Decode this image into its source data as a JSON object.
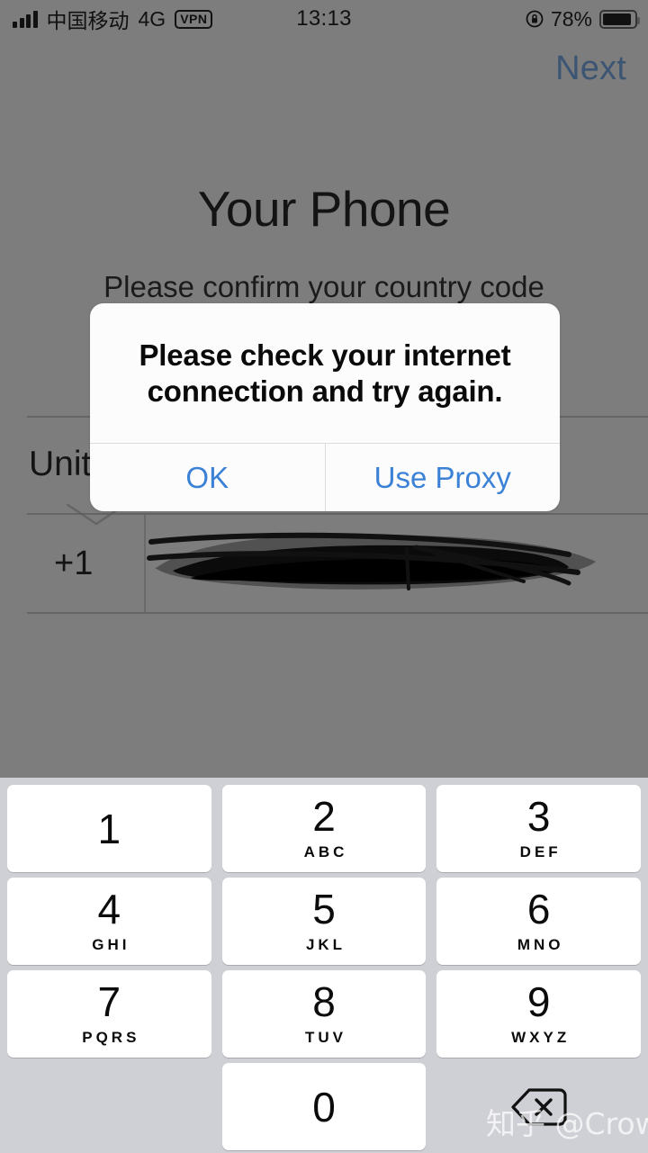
{
  "status_bar": {
    "carrier": "中国移动",
    "network": "4G",
    "vpn_badge": "VPN",
    "time": "13:13",
    "battery_percent": "78%",
    "signal_icon": "signal-bars-icon",
    "rotation_lock_icon": "rotation-lock-icon",
    "battery_icon": "battery-icon"
  },
  "nav": {
    "next_label": "Next"
  },
  "page": {
    "title": "Your Phone",
    "subtitle": "Please confirm your country code"
  },
  "form": {
    "country_name": "United States",
    "country_chevron_icon": "chevron-down-icon",
    "dial_code": "+1",
    "phone_number": "",
    "phone_redacted_note": "redacted"
  },
  "alert": {
    "message": "Please check your internet connection and try again.",
    "buttons": [
      {
        "label": "OK"
      },
      {
        "label": "Use Proxy"
      }
    ]
  },
  "keypad": {
    "keys": [
      {
        "digit": "1",
        "letters": ""
      },
      {
        "digit": "2",
        "letters": "ABC"
      },
      {
        "digit": "3",
        "letters": "DEF"
      },
      {
        "digit": "4",
        "letters": "GHI"
      },
      {
        "digit": "5",
        "letters": "JKL"
      },
      {
        "digit": "6",
        "letters": "MNO"
      },
      {
        "digit": "7",
        "letters": "PQRS"
      },
      {
        "digit": "8",
        "letters": "TUV"
      },
      {
        "digit": "9",
        "letters": "WXYZ"
      },
      {
        "digit": "0",
        "letters": ""
      }
    ],
    "backspace_icon": "backspace-icon"
  },
  "watermark": {
    "text": "知乎 @Crown"
  },
  "colors": {
    "dim_overlay": "#7d7d7d",
    "alert_background": "#fcfcfc",
    "alert_button_blue": "#3b82d6",
    "next_blue_dimmed": "#3b5573",
    "keypad_background": "#cfd0d6",
    "key_white": "#ffffff"
  }
}
